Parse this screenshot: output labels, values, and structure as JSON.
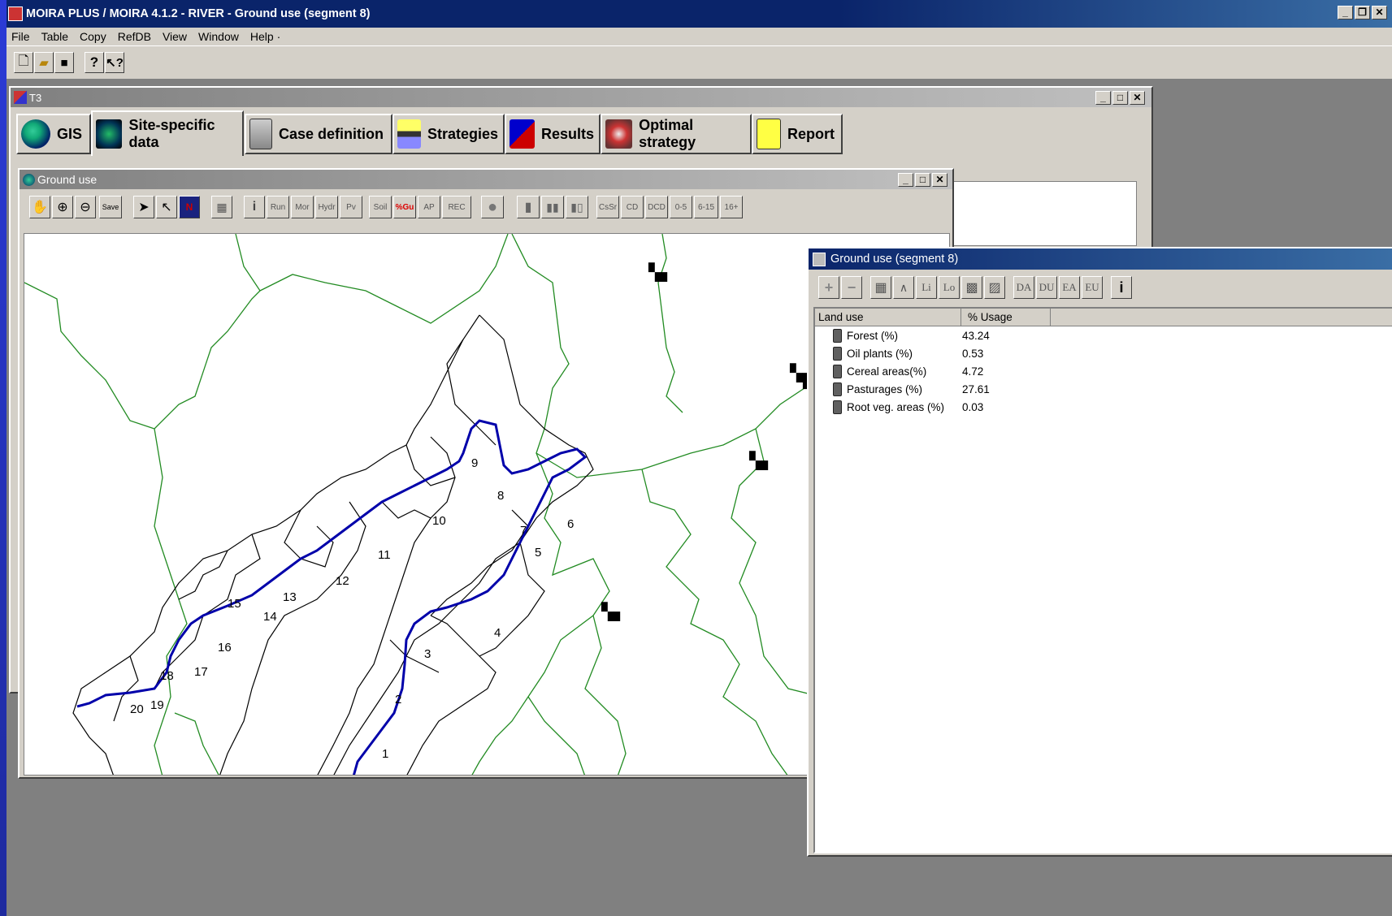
{
  "app_title": "MOIRA PLUS / MOIRA 4.1.2 - RIVER -  Ground use (segment 8)",
  "menu": [
    "File",
    "Table",
    "Copy",
    "RefDB",
    "View",
    "Window",
    "Help"
  ],
  "menu_extra": "·",
  "toolbar_icons": [
    "new-file-icon",
    "open-folder-icon",
    "save-disk-icon",
    "help-icon",
    "context-help-icon"
  ],
  "child_window": {
    "title": "T3",
    "tabs": [
      {
        "label": "GIS",
        "icon": "globe-icon"
      },
      {
        "label": "Site-specific data",
        "icon": "world-map-icon"
      },
      {
        "label": "Case definition",
        "icon": "cabinet-icon"
      },
      {
        "label": "Strategies",
        "icon": "strategy-icon"
      },
      {
        "label": "Results",
        "icon": "results-icon"
      },
      {
        "label": "Optimal strategy",
        "icon": "optimal-icon"
      },
      {
        "label": "Report",
        "icon": "report-icon"
      }
    ]
  },
  "map_window": {
    "title": "Ground use",
    "tools": [
      "Save",
      "Run",
      "Mor",
      "Hydr",
      "Pv",
      "Soil",
      "%Gu",
      "AP",
      "REC",
      "CsSr",
      "CD",
      "DCD",
      "0-5",
      "6-15",
      "16+"
    ],
    "segment_labels": [
      "1",
      "2",
      "3",
      "4",
      "5",
      "6",
      "7",
      "8",
      "9",
      "10",
      "11",
      "12",
      "13",
      "14",
      "15",
      "16",
      "17",
      "18",
      "19",
      "20"
    ]
  },
  "data_window": {
    "title": "Ground use (segment 8)",
    "tools": [
      "+",
      "−",
      "Li",
      "Lo",
      "DA",
      "DU",
      "EA",
      "EU",
      "i"
    ],
    "columns": [
      "Land use",
      "% Usage"
    ],
    "rows": [
      {
        "land_use": "Forest (%)",
        "usage": "43.24"
      },
      {
        "land_use": "Oil plants (%)",
        "usage": "0.53"
      },
      {
        "land_use": "Cereal areas(%)",
        "usage": "4.72"
      },
      {
        "land_use": "Pasturages (%)",
        "usage": "27.61"
      },
      {
        "land_use": "Root veg. areas (%)",
        "usage": "0.03"
      }
    ]
  },
  "colors": {
    "titlebar": "#0a246a",
    "titlebar_end": "#a6caf0",
    "inactive_titlebar": "#808080",
    "river": "#0000aa",
    "borders": "#228b22",
    "segments": "#000000",
    "desktop": "#808080",
    "left_strip": "#2b3bd6"
  }
}
